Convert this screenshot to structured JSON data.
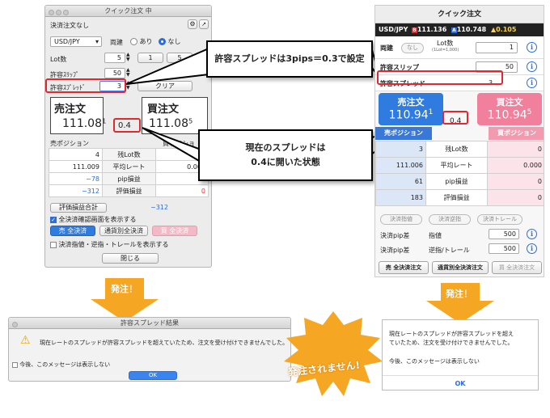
{
  "desktop": {
    "title": "クイック注文 中",
    "mode": "決済注文なし",
    "pair": "USD/JPY",
    "both_label": "両建",
    "radio_yes": "あり",
    "radio_no": "なし",
    "lot_label": "Lot数",
    "lot_value": "5",
    "lot_presets": [
      "1",
      "5"
    ],
    "slip_label": "許容ｽﾘｯﾌﾟ",
    "slip_value": "50",
    "spread_label": "許容ｽﾌﾟﾚｯﾄﾞ",
    "spread_value": "3",
    "clear": "クリア",
    "sell_label": "売注文",
    "sell_main": "111.08",
    "sell_sub": "1",
    "buy_label": "買注文",
    "buy_main": "111.08",
    "buy_sub": "5",
    "spread_now": "0.4",
    "sell_pos_head": "売ポジション",
    "buy_pos_head": "買ポジショ",
    "rows": [
      {
        "left": "4",
        "label": "残Lot数",
        "right": "0"
      },
      {
        "left": "111.009",
        "label": "平均レート",
        "right": "0.000"
      },
      {
        "left": "−78",
        "label": "pip損益",
        "right": "0"
      },
      {
        "left": "−312",
        "label": "評価損益",
        "right": "0"
      }
    ],
    "total_label": "評価損益合計",
    "total_value": "−312",
    "confirm_check": "全決済確認画面を表示する",
    "sell_all": "売 全決済",
    "currency_all": "通貨別全決済",
    "buy_all": "買 全決済",
    "show_check": "決済指値・逆指・トレールを表示する",
    "close": "閉じる"
  },
  "mobile": {
    "title": "クイック注文",
    "pair": "USD/JPY",
    "bid_tag": "B",
    "bid": "111.136",
    "ask_tag": "A",
    "ask": "110.748",
    "change": "▲0.105",
    "both_label": "両建",
    "both_toggle": "なし",
    "lot_label": "Lot数",
    "lot_note": "(1Lot=1,000)",
    "lot_value": "1",
    "slip_label": "許容スリップ",
    "slip_value": "50",
    "spread_label": "許容スプレッド",
    "spread_value": "3",
    "sell_label": "売注文",
    "sell_main": "110.94",
    "sell_sub": "1",
    "buy_label": "買注文",
    "buy_main": "110.94",
    "buy_sub": "5",
    "spread_now": "0.4",
    "sell_pos": "売ポジション",
    "buy_pos": "買ポジション",
    "rows": [
      {
        "left": "3",
        "label": "残Lot数",
        "right": "0"
      },
      {
        "left": "111.006",
        "label": "平均レート",
        "right": "0.000"
      },
      {
        "left": "61",
        "label": "pip損益",
        "right": "0"
      },
      {
        "left": "183",
        "label": "評価損益",
        "right": "0"
      }
    ],
    "chk_limit": "決済指値",
    "chk_stop": "決済逆指",
    "chk_trail": "決済トレール",
    "pip_limit_label": "決済pip差",
    "pip_limit_type": "指値",
    "pip_limit_value": "500",
    "pip_stop_label": "決済pip差",
    "pip_stop_type": "逆指/トレール",
    "pip_stop_value": "500",
    "sell_all": "売 全決済注文",
    "currency_all": "通貨別全決済注文",
    "buy_all": "買 全決済注文"
  },
  "callouts": {
    "spread_setting": "許容スプレッドは3pips＝0.3で設定",
    "spread_line1": "現在のスプレッドは",
    "spread_line2": "0.4に開いた状態",
    "order_left": "発注！",
    "order_right": "発注！",
    "not_ordered": "発注されません!"
  },
  "dialog": {
    "title": "許容スプレッド結果",
    "message": "現在レートのスプレッドが許容スプレッドを超えていたため、注文を受け付けできませんでした。",
    "dont_show": "今後、このメッセージは表示しない",
    "ok": "OK"
  },
  "mdialog": {
    "line1": "現在レートのスプレッドが許容スプレッドを超え",
    "line2": "ていたため、注文を受け付けできませんでした。",
    "line3": "今後、このメッセージは表示しない",
    "ok": "OK"
  },
  "colors": {
    "sell": "#2f7be0",
    "buy": "#e8547a",
    "accent_red": "#e0282e",
    "arrow": "#f5a623"
  }
}
